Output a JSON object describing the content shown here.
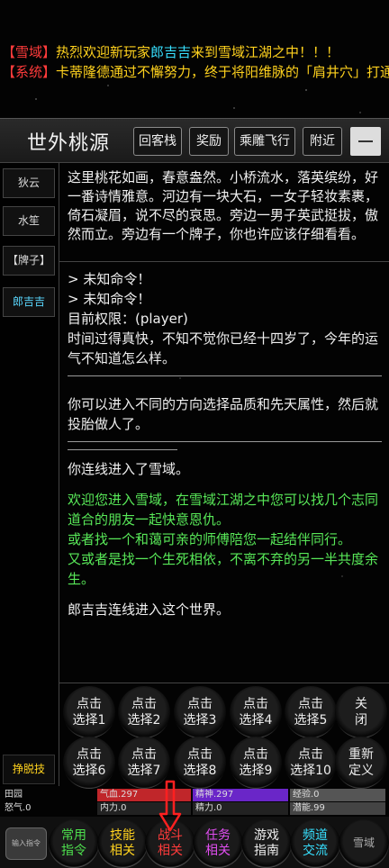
{
  "broadcast": [
    {
      "tag": "【雪域】",
      "segments": [
        {
          "text": "热烈欢迎新玩家",
          "color": "yellow"
        },
        {
          "text": "郎吉吉",
          "color": "cyan"
        },
        {
          "text": "来到雪域江湖之中！！！",
          "color": "yellow"
        }
      ]
    },
    {
      "tag": "【系统】",
      "segments": [
        {
          "text": "卡蒂隆德通过不懈努力，终于将阳维脉的「肩井穴」打通了",
          "color": "yellow"
        }
      ]
    }
  ],
  "header": {
    "room_name": "世外桃源",
    "buttons": [
      "回客栈",
      "奖励",
      "乘雕飞行",
      "附近"
    ]
  },
  "npcs": [
    "狄云",
    "水笙",
    "【牌子】",
    "郎吉吉"
  ],
  "escape_label": "挣脱技",
  "room_desc": "这里桃花如画，春意盎然。小桥流水，落英缤纷，好一番诗情雅意。河边有一块大石，一女子轻妆素裹，倚石凝眉，说不尽的哀思。旁边一男子英武挺拔，傲然而立。旁边有一个牌子，你也许应该仔细看看。",
  "log": {
    "unknown1": "> 未知命令！",
    "unknown2": "> 未知命令！",
    "permission": "目前权限：(player)",
    "age_msg": "时间过得真快，不知不觉你已经十四岁了，今年的运气不知道怎么样。",
    "reincarnate": "你可以进入不同的方向选择品质和先天属性，然后就投胎做人了。",
    "connected": "你连线进入了雪域。",
    "welcome1": "欢迎您进入雪域，在雪域江湖之中您可以找几个志同道合的朋友一起快意恩仇。",
    "welcome2": "或者找一个和蔼可亲的师傅陪您一起结伴同行。",
    "welcome3": "又或者是找一个生死相依，不离不弃的另一半共度余生。",
    "player_joined": "郎吉吉连线进入这个世界。"
  },
  "choices": {
    "row1": [
      [
        "点击",
        "选择1"
      ],
      [
        "点击",
        "选择2"
      ],
      [
        "点击",
        "选择3"
      ],
      [
        "点击",
        "选择4"
      ],
      [
        "点击",
        "选择5"
      ],
      [
        "关",
        "闭"
      ]
    ],
    "row2": [
      [
        "点击",
        "选择6"
      ],
      [
        "点击",
        "选择7"
      ],
      [
        "点击",
        "选择8"
      ],
      [
        "点击",
        "选择9"
      ],
      [
        "点击",
        "选择10"
      ],
      [
        "重新",
        "定义"
      ]
    ]
  },
  "stats": {
    "field": "田园",
    "qixue": "气血.297",
    "jingshen": "精神.297",
    "jingyan": "经验.0",
    "nuqi": "怒气.0",
    "neili": "内力.0",
    "jingli": "精力.0",
    "qianneng": "潜能.99"
  },
  "bottom": {
    "input_label": "输入指令",
    "buttons": [
      {
        "l1": "常用",
        "l2": "指令",
        "color": "#4ee04e"
      },
      {
        "l1": "技能",
        "l2": "相关",
        "color": "#ffd21e"
      },
      {
        "l1": "战斗",
        "l2": "相关",
        "color": "#ff3b3b"
      },
      {
        "l1": "任务",
        "l2": "相关",
        "color": "#e04ef0"
      },
      {
        "l1": "游戏",
        "l2": "指南",
        "color": "#eeeeee"
      },
      {
        "l1": "频道",
        "l2": "交流",
        "color": "#37e0ff"
      }
    ],
    "logo_text": "雪域"
  },
  "colors": {
    "yellow": "#ffd21e",
    "cyan": "#37e0ff",
    "red": "#ff3b3b",
    "green": "#58e858"
  }
}
